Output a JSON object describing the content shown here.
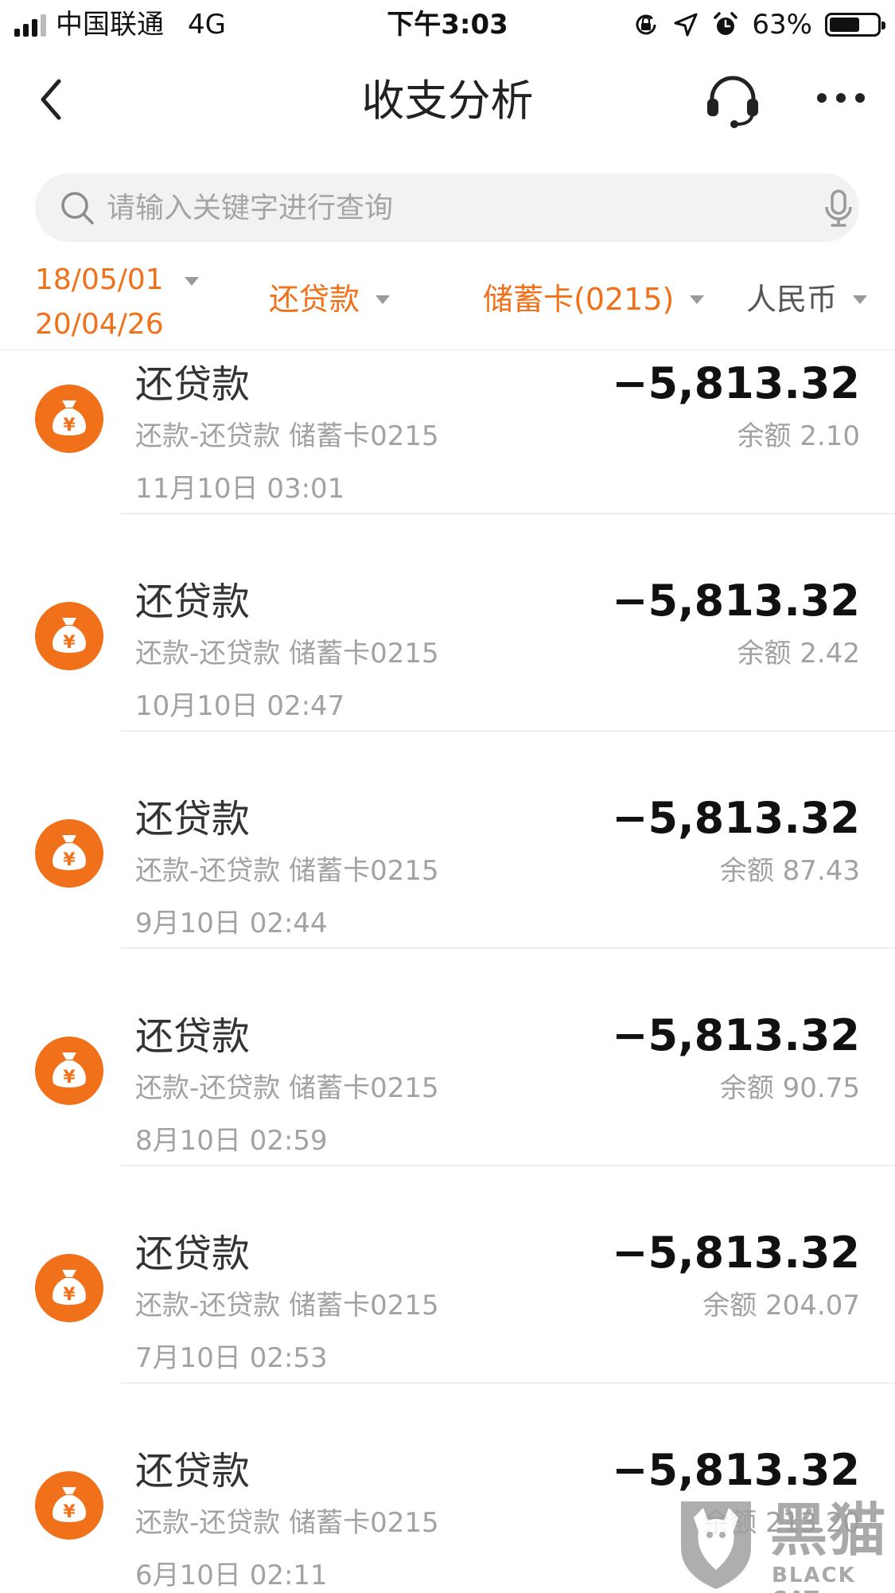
{
  "status_bar": {
    "carrier": "中国联通",
    "network": "4G",
    "time": "下午3:03",
    "battery_percent": "63%",
    "battery_level": 0.63,
    "icons": [
      "signal-icon",
      "rotation-lock-icon",
      "location-icon",
      "alarm-icon",
      "battery-icon"
    ]
  },
  "nav": {
    "title": "收支分析",
    "icons": [
      "chevron-left-icon",
      "headset-icon",
      "more-icon"
    ]
  },
  "search": {
    "placeholder": "请输入关键字进行查询",
    "value": ""
  },
  "filters": {
    "date_start": "18/05/01",
    "date_end": "20/04/26",
    "category": "还贷款",
    "account": "储蓄卡(0215)",
    "currency": "人民币"
  },
  "colors": {
    "accent": "#f0711a",
    "secondary_text": "#a2a2a2"
  },
  "transactions": [
    {
      "title": "还贷款",
      "subtitle": "还款-还贷款 储蓄卡0215",
      "time": "11月10日 03:01",
      "amount": "−5,813.32",
      "balance": "余额 2.10",
      "icon": "money-bag-icon"
    },
    {
      "title": "还贷款",
      "subtitle": "还款-还贷款 储蓄卡0215",
      "time": "10月10日 02:47",
      "amount": "−5,813.32",
      "balance": "余额 2.42",
      "icon": "money-bag-icon"
    },
    {
      "title": "还贷款",
      "subtitle": "还款-还贷款 储蓄卡0215",
      "time": "9月10日 02:44",
      "amount": "−5,813.32",
      "balance": "余额 87.43",
      "icon": "money-bag-icon"
    },
    {
      "title": "还贷款",
      "subtitle": "还款-还贷款 储蓄卡0215",
      "time": "8月10日 02:59",
      "amount": "−5,813.32",
      "balance": "余额 90.75",
      "icon": "money-bag-icon"
    },
    {
      "title": "还贷款",
      "subtitle": "还款-还贷款 储蓄卡0215",
      "time": "7月10日 02:53",
      "amount": "−5,813.32",
      "balance": "余额 204.07",
      "icon": "money-bag-icon"
    },
    {
      "title": "还贷款",
      "subtitle": "还款-还贷款 储蓄卡0215",
      "time": "6月10日 02:11",
      "amount": "−5,813.32",
      "balance": "余额 213.20",
      "icon": "money-bag-icon"
    }
  ],
  "watermark": {
    "text_cn": "黑猫",
    "text_en": "BLACK CAT"
  }
}
